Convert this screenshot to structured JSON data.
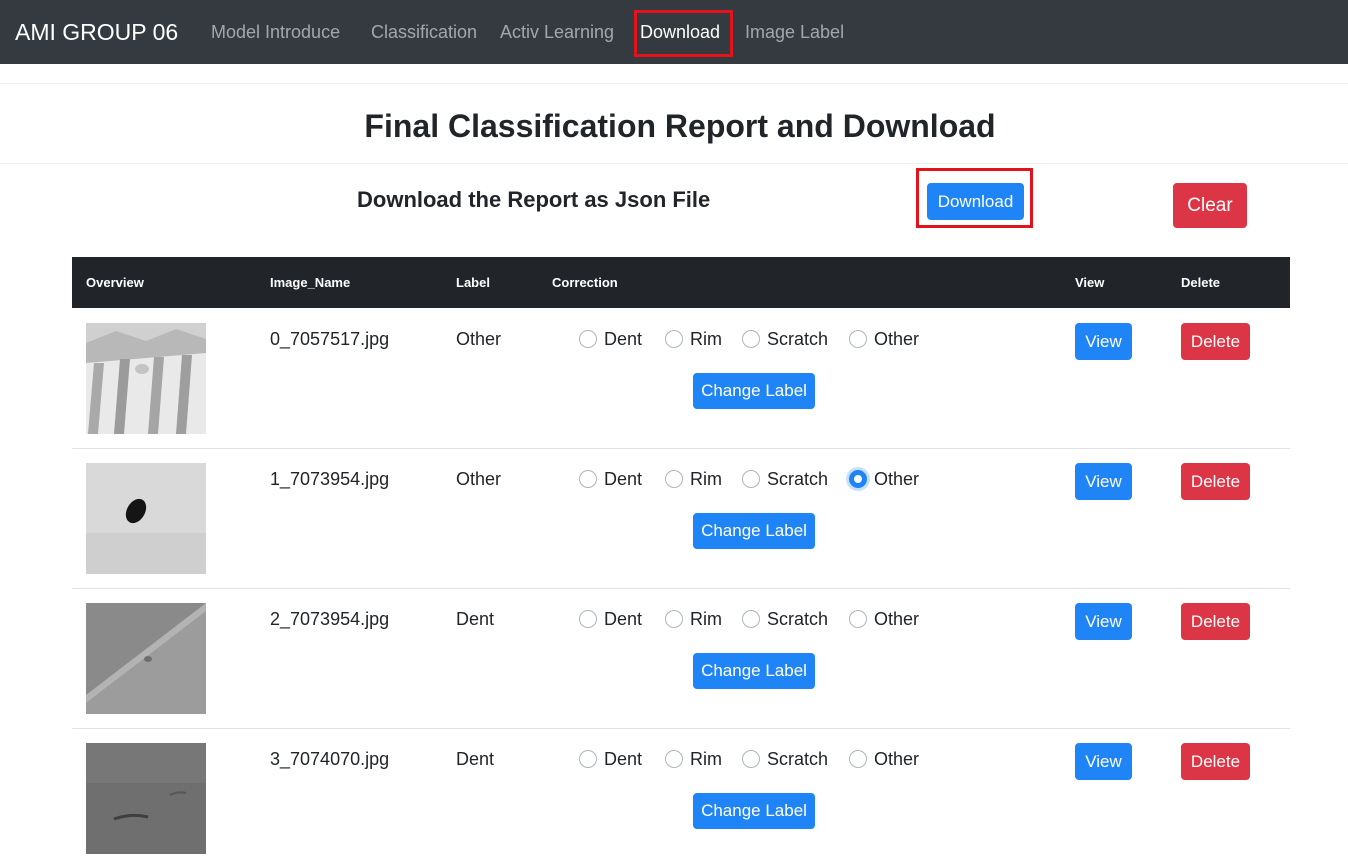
{
  "navbar": {
    "brand": "AMI GROUP 06",
    "links": [
      "Model Introduce",
      "Classification",
      "Activ Learning",
      "Download",
      "Image Label"
    ],
    "active_index": 3
  },
  "page": {
    "title": "Final Classification Report and Download",
    "subtitle": "Download the Report as Json File",
    "download_button": "Download",
    "clear_button": "Clear"
  },
  "table": {
    "headers": [
      "Overview",
      "Image_Name",
      "Label",
      "Correction",
      "View",
      "Delete"
    ],
    "correction_options": [
      "Dent",
      "Rim",
      "Scratch",
      "Other"
    ],
    "change_label_button": "Change Label",
    "view_button": "View",
    "delete_button": "Delete",
    "rows": [
      {
        "image_name": "0_7057517.jpg",
        "label": "Other",
        "selected_option": null
      },
      {
        "image_name": "1_7073954.jpg",
        "label": "Other",
        "selected_option": "Other"
      },
      {
        "image_name": "2_7073954.jpg",
        "label": "Dent",
        "selected_option": null
      },
      {
        "image_name": "3_7074070.jpg",
        "label": "Dent",
        "selected_option": null
      }
    ]
  },
  "colors": {
    "navbar_bg": "#343a40",
    "primary": "#1f85f6",
    "danger": "#dc3545",
    "highlight_box": "#e3121b",
    "table_head_bg": "#212529"
  }
}
